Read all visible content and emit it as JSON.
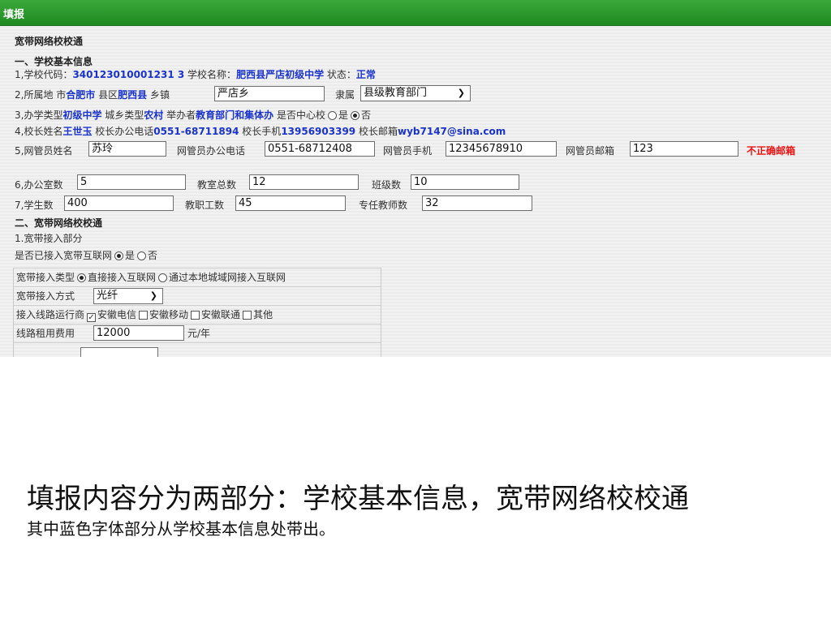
{
  "window": {
    "title": "填报"
  },
  "section_title": "宽带网络校校通",
  "basic": {
    "heading": "一、学校基本信息",
    "l1": {
      "p1": "1,学校代码：",
      "code": "340123010001231 3",
      "p2": " 学校名称：",
      "name": "肥西县严店初级中学",
      "p3": " 状态：",
      "status": "正常"
    },
    "l2": {
      "p1": "2,所属地 市",
      "city": "合肥市",
      "p2": " 县区",
      "county": "肥西县",
      "p3": " 乡镇",
      "town": "严店乡",
      "belong_label": "隶属",
      "belong": "县级教育部门"
    },
    "l3": {
      "p1": "3,办学类型",
      "type": "初级中学",
      "p2": " 城乡类型",
      "area": "农村",
      "p3": " 举办者",
      "host": "教育部门和集体办",
      "p4": " 是否中心校",
      "yes": "是",
      "no": "否"
    },
    "l4": {
      "p1": "4,校长姓名",
      "principal": "王世玉",
      "p2": " 校长办公电话",
      "office_phone": "0551-68711894",
      "p3": " 校长手机",
      "mobile": "13956903399",
      "p4": " 校长邮箱",
      "email": "wyb7147@sina.com"
    },
    "l5": {
      "name_label": "5,网管员姓名",
      "name": "苏玲",
      "phone_label": "网管员办公电话",
      "phone": "0551-68712408",
      "mobile_label": "网管员手机",
      "mobile": "12345678910",
      "email_label": "网管员邮箱",
      "email": "123",
      "email_error": "不正确邮箱"
    },
    "l6": {
      "offices_label": "6,办公室数",
      "offices": "5",
      "classrooms_label": "教室总数",
      "classrooms": "12",
      "classes_label": "班级数",
      "classes": "10"
    },
    "l7": {
      "students_label": "7,学生数",
      "students": "400",
      "staff_label": "教职工数",
      "staff": "45",
      "teachers_label": "专任教师数",
      "teachers": "32"
    }
  },
  "broadband": {
    "heading": "二、宽带网络校校通",
    "sub": "1.宽带接入部分",
    "connected_label": "是否已接入宽带互联网",
    "yes": "是",
    "no": "否",
    "table": {
      "type_label": "宽带接入类型",
      "type_opt1": "直接接入互联网",
      "type_opt2": "通过本地城域网接入互联网",
      "method_label": "宽带接入方式",
      "method": "光纤",
      "carrier_label": "接入线路运行商",
      "carriers": [
        "安徽电信",
        "安徽移动",
        "安徽联通",
        "其他"
      ],
      "fee_label": "线路租用费用",
      "fee": "12000",
      "fee_unit": "元/年"
    }
  },
  "caption": {
    "line1": "填报内容分为两部分：学校基本信息，宽带网络校校通",
    "line2": "其中蓝色字体部分从学校基本信息处带出。"
  },
  "colors": {
    "titlebar": "#1f8a22",
    "link_blue": "#1a33cc",
    "error_red": "#ee1111"
  }
}
